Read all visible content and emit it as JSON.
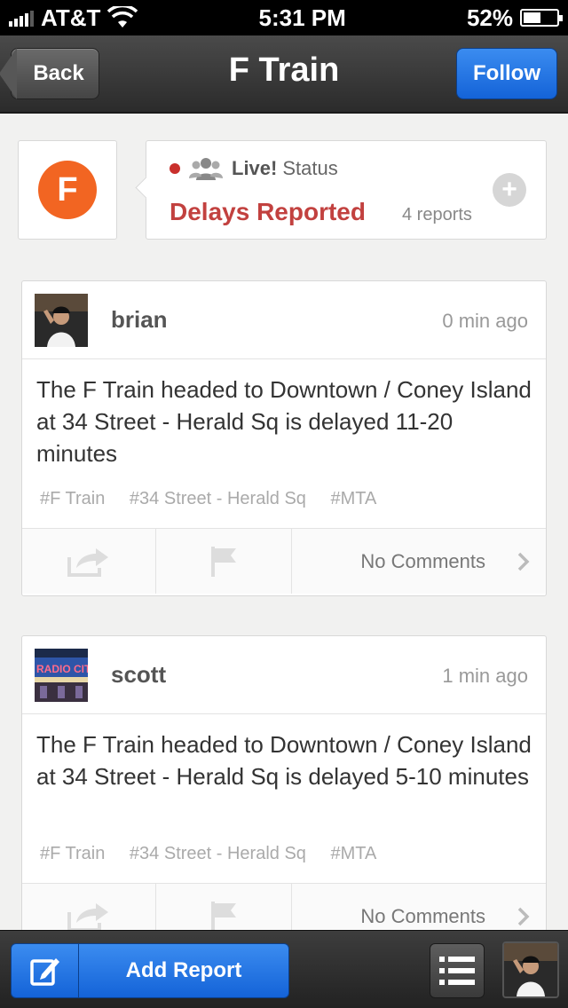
{
  "status_bar": {
    "carrier": "AT&T",
    "time": "5:31 PM",
    "battery": "52%",
    "battery_level": 0.52
  },
  "nav": {
    "back_label": "Back",
    "title": "F Train",
    "follow_label": "Follow"
  },
  "line": {
    "badge": "F",
    "badge_color": "#f26522",
    "live_label": "Live!",
    "status_label": "Status",
    "status_text": "Delays Reported",
    "report_count": "4 reports",
    "status_color": "#c2413f"
  },
  "posts": [
    {
      "user": "brian",
      "time": "0 min ago",
      "text": "The F Train headed to Downtown / Coney Island at 34 Street - Herald Sq is delayed 11-20 minutes",
      "tags": [
        "#F Train",
        "#34 Street - Herald Sq",
        "#MTA"
      ],
      "comments": "No Comments"
    },
    {
      "user": "scott",
      "time": "1 min ago",
      "text": "The F Train headed to Downtown / Coney Island at 34 Street - Herald Sq is delayed 5-10 minutes",
      "tags": [
        "#F Train",
        "#34 Street - Herald Sq",
        "#MTA"
      ],
      "comments": "No Comments"
    }
  ],
  "toolbar": {
    "add_report_label": "Add Report"
  },
  "colors": {
    "accent_blue": "#1463d8",
    "nav_dark": "#2b2b2b"
  }
}
